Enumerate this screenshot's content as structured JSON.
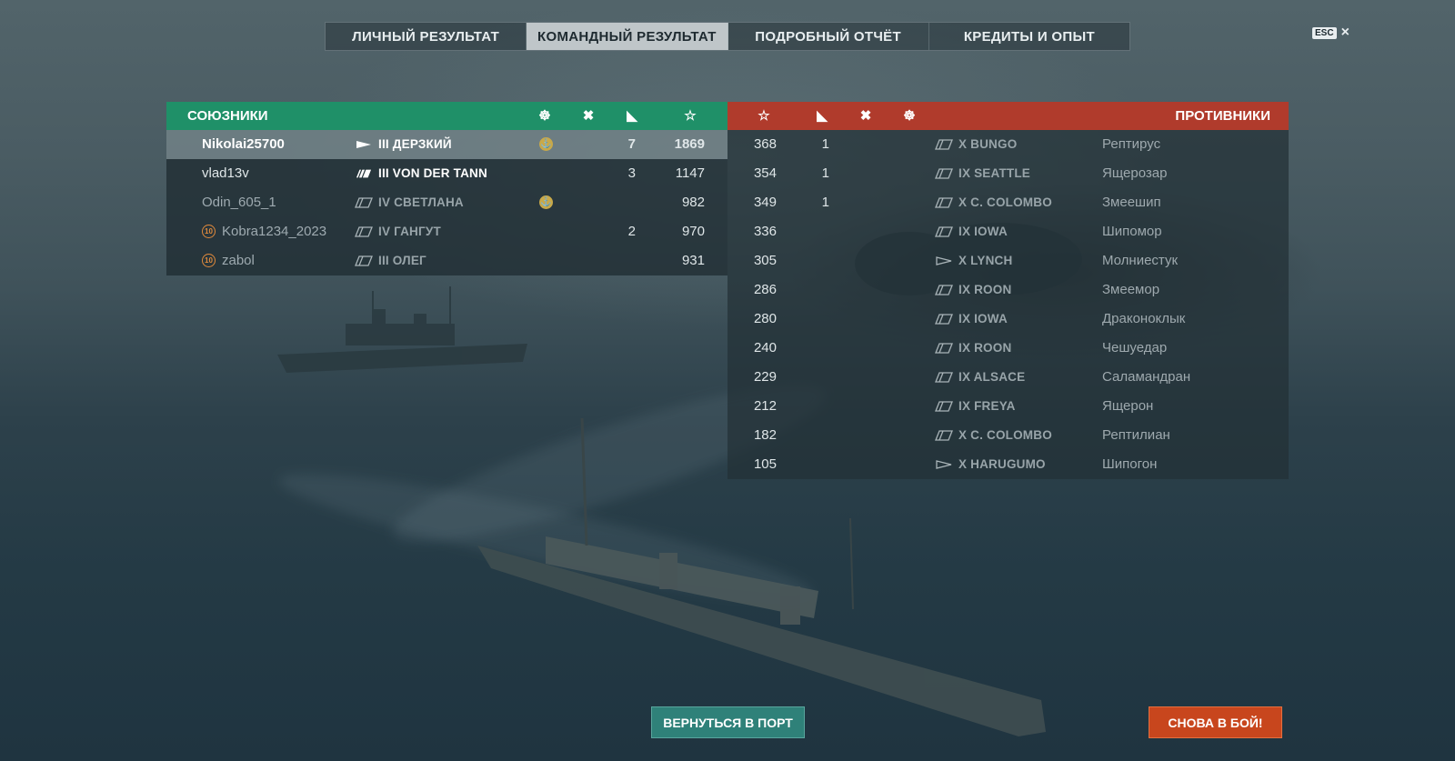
{
  "tabs": [
    {
      "label": "ЛИЧНЫЙ РЕЗУЛЬТАТ",
      "active": false
    },
    {
      "label": "КОМАНДНЫЙ РЕЗУЛЬТАТ",
      "active": true
    },
    {
      "label": "ПОДРОБНЫЙ ОТЧЁТ",
      "active": false
    },
    {
      "label": "КРЕДИТЫ И ОПЫТ",
      "active": false
    }
  ],
  "esc": {
    "key": "ESC",
    "close": "×"
  },
  "allies": {
    "title": "СОЮЗНИКИ",
    "color": "#1f9068",
    "header_icons": [
      "capture-icon",
      "cross-icon",
      "kills-icon",
      "star-icon"
    ],
    "rows": [
      {
        "player": "Nikolai25700",
        "ship": "III ДЕРЗКИЙ",
        "medal": "⚓",
        "kills": "7",
        "exp": "1869",
        "me": true
      },
      {
        "player": "vlad13v",
        "ship": "III VON DER TANN",
        "medal": "",
        "kills": "3",
        "exp": "1147"
      },
      {
        "player": "Odin_605_1",
        "ship": "IV СВЕТЛАНА",
        "medal": "⚓",
        "kills": "",
        "exp": "982",
        "dim": true
      },
      {
        "player": "Kobra1234_2023",
        "ship": "IV ГАНГУТ",
        "medal": "",
        "kills": "2",
        "exp": "970",
        "dim": true,
        "badge": "10"
      },
      {
        "player": "zabol",
        "ship": "III ОЛЕГ",
        "medal": "",
        "kills": "",
        "exp": "931",
        "dim": true,
        "badge": "10"
      }
    ]
  },
  "enemies": {
    "title": "ПРОТИВНИКИ",
    "color": "#b03b2c",
    "header_icons": [
      "star-icon",
      "kills-icon",
      "cross-icon",
      "capture-icon"
    ],
    "rows": [
      {
        "exp": "368",
        "kills": "1",
        "ship": "X BUNGO",
        "player": "Рептирус"
      },
      {
        "exp": "354",
        "kills": "1",
        "ship": "IX SEATTLE",
        "player": "Ящерозар"
      },
      {
        "exp": "349",
        "kills": "1",
        "ship": "X C. COLOMBO",
        "player": "Змеешип"
      },
      {
        "exp": "336",
        "kills": "",
        "ship": "IX IOWA",
        "player": "Шипомор"
      },
      {
        "exp": "305",
        "kills": "",
        "ship": "X LYNCH",
        "player": "Молниестук"
      },
      {
        "exp": "286",
        "kills": "",
        "ship": "IX ROON",
        "player": "Змеемор"
      },
      {
        "exp": "280",
        "kills": "",
        "ship": "IX IOWA",
        "player": "Драконоклык"
      },
      {
        "exp": "240",
        "kills": "",
        "ship": "IX ROON",
        "player": "Чешуедар"
      },
      {
        "exp": "229",
        "kills": "",
        "ship": "IX ALSACE",
        "player": "Саламандран"
      },
      {
        "exp": "212",
        "kills": "",
        "ship": "IX FREYA",
        "player": "Ящерон"
      },
      {
        "exp": "182",
        "kills": "",
        "ship": "X C. COLOMBO",
        "player": "Рептилиан"
      },
      {
        "exp": "105",
        "kills": "",
        "ship": "X HARUGUMO",
        "player": "Шипогон"
      }
    ]
  },
  "buttons": {
    "port": "ВЕРНУТЬСЯ В ПОРТ",
    "battle": "СНОВА В БОЙ!"
  }
}
